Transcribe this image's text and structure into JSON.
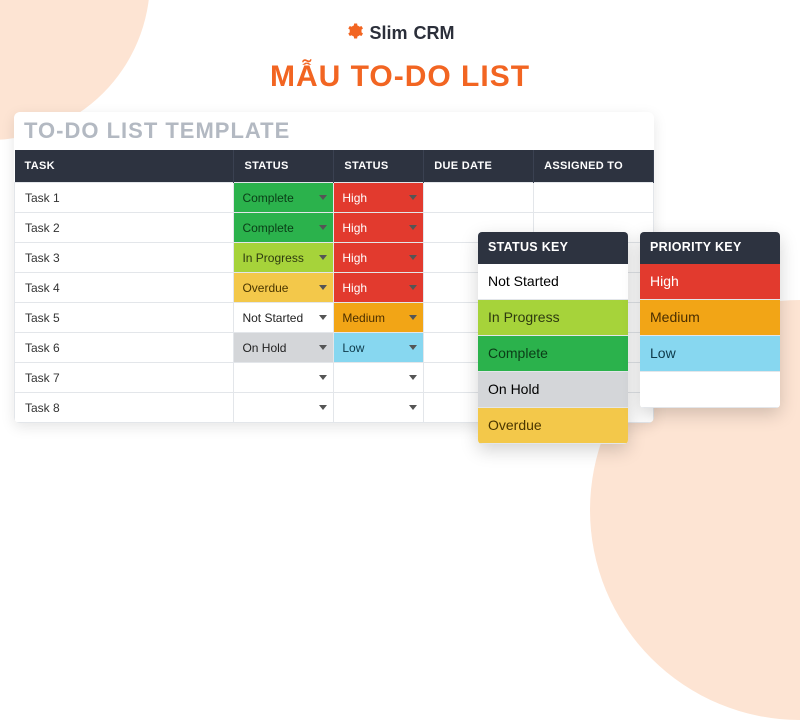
{
  "brand": {
    "name": "Slim",
    "suffix": "CRM"
  },
  "page_title": "MẪU TO-DO LIST",
  "sheet_title": "TO-DO LIST TEMPLATE",
  "columns": {
    "task": "TASK",
    "status": "STATUS",
    "priority": "STATUS",
    "due": "DUE DATE",
    "assigned": "ASSIGNED TO"
  },
  "rows": [
    {
      "task": "Task 1",
      "status": "Complete",
      "status_class": "bg-complete",
      "priority": "High",
      "priority_class": "bg-high"
    },
    {
      "task": "Task 2",
      "status": "Complete",
      "status_class": "bg-complete",
      "priority": "High",
      "priority_class": "bg-high"
    },
    {
      "task": "Task 3",
      "status": "In Progress",
      "status_class": "bg-inprogress",
      "priority": "High",
      "priority_class": "bg-high"
    },
    {
      "task": "Task 4",
      "status": "Overdue",
      "status_class": "bg-overdue",
      "priority": "High",
      "priority_class": "bg-high"
    },
    {
      "task": "Task 5",
      "status": "Not Started",
      "status_class": "bg-notstarted",
      "priority": "Medium",
      "priority_class": "bg-medium"
    },
    {
      "task": "Task 6",
      "status": "On Hold",
      "status_class": "bg-onhold",
      "priority": "Low",
      "priority_class": "bg-low"
    },
    {
      "task": "Task 7",
      "status": "",
      "status_class": "bg-empty",
      "priority": "",
      "priority_class": "bg-empty"
    },
    {
      "task": "Task 8",
      "status": "",
      "status_class": "bg-empty",
      "priority": "",
      "priority_class": "bg-empty"
    }
  ],
  "status_key": {
    "title": "STATUS KEY",
    "items": [
      {
        "label": "Not Started",
        "class": "bg-notstarted"
      },
      {
        "label": "In Progress",
        "class": "bg-inprogress"
      },
      {
        "label": "Complete",
        "class": "bg-complete"
      },
      {
        "label": "On Hold",
        "class": "bg-onhold"
      },
      {
        "label": "Overdue",
        "class": "bg-overdue"
      }
    ]
  },
  "priority_key": {
    "title": "PRIORITY KEY",
    "items": [
      {
        "label": "High",
        "class": "bg-high"
      },
      {
        "label": "Medium",
        "class": "bg-medium"
      },
      {
        "label": "Low",
        "class": "bg-low"
      },
      {
        "label": "",
        "class": "bg-empty"
      }
    ]
  }
}
